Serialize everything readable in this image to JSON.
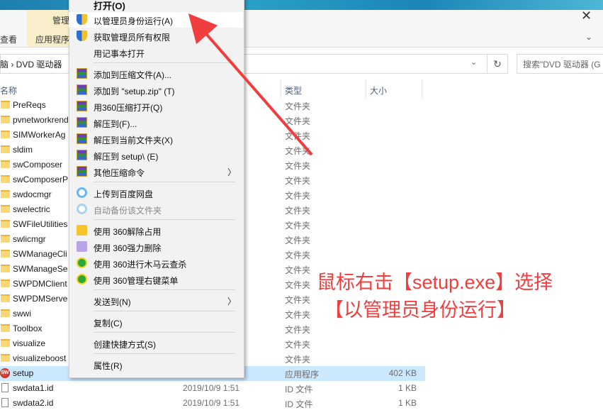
{
  "ribbon": {
    "manage_tab": "管理",
    "view_tab": "查看",
    "app_tools_tab": "应用程序"
  },
  "address": {
    "path": "脑 › DVD 驱动器",
    "search_placeholder": "搜索\"DVD 驱动器 (G"
  },
  "columns": {
    "name": "名称",
    "type": "类型",
    "size": "大小"
  },
  "files": [
    {
      "name": "PreReqs",
      "date": "",
      "type": "文件夹",
      "size": "",
      "kind": "folder"
    },
    {
      "name": "pvnetworkrend",
      "date": "",
      "type": "文件夹",
      "size": "",
      "kind": "folder"
    },
    {
      "name": "SIMWorkerAg",
      "date": "",
      "type": "文件夹",
      "size": "",
      "kind": "folder"
    },
    {
      "name": "sldim",
      "date": "",
      "type": "文件夹",
      "size": "",
      "kind": "folder"
    },
    {
      "name": "swComposer",
      "date": "",
      "type": "文件夹",
      "size": "",
      "kind": "folder"
    },
    {
      "name": "swComposerP",
      "date": "",
      "type": "文件夹",
      "size": "",
      "kind": "folder"
    },
    {
      "name": "swdocmgr",
      "date": "",
      "type": "文件夹",
      "size": "",
      "kind": "folder"
    },
    {
      "name": "swelectric",
      "date": "",
      "type": "文件夹",
      "size": "",
      "kind": "folder"
    },
    {
      "name": "SWFileUtilities",
      "date": "",
      "type": "文件夹",
      "size": "",
      "kind": "folder"
    },
    {
      "name": "swlicmgr",
      "date": "",
      "type": "文件夹",
      "size": "",
      "kind": "folder"
    },
    {
      "name": "SWManageCli",
      "date": "",
      "type": "文件夹",
      "size": "",
      "kind": "folder"
    },
    {
      "name": "SWManageSe",
      "date": "",
      "type": "文件夹",
      "size": "",
      "kind": "folder"
    },
    {
      "name": "SWPDMClient",
      "date": "",
      "type": "文件夹",
      "size": "",
      "kind": "folder"
    },
    {
      "name": "SWPDMServe",
      "date": "",
      "type": "文件夹",
      "size": "",
      "kind": "folder"
    },
    {
      "name": "swwi",
      "date": "",
      "type": "文件夹",
      "size": "",
      "kind": "folder"
    },
    {
      "name": "Toolbox",
      "date": "",
      "type": "文件夹",
      "size": "",
      "kind": "folder"
    },
    {
      "name": "visualize",
      "date": "",
      "type": "文件夹",
      "size": "",
      "kind": "folder"
    },
    {
      "name": "visualizeboost",
      "date": "",
      "type": "文件夹",
      "size": "",
      "kind": "folder"
    },
    {
      "name": "setup",
      "date": "",
      "type": "应用程序",
      "size": "402 KB",
      "kind": "exe"
    },
    {
      "name": "swdata1.id",
      "date": "2019/10/9 1:51",
      "type": "ID 文件",
      "size": "1 KB",
      "kind": "file"
    },
    {
      "name": "swdata2.id",
      "date": "2019/10/9 1:51",
      "type": "ID 文件",
      "size": "1 KB",
      "kind": "file"
    }
  ],
  "context_menu": {
    "open": "打开(O)",
    "run_as_admin": "以管理员身份运行(A)",
    "take_ownership": "获取管理员所有权限",
    "open_notepad": "用记事本打开",
    "add_to_archive": "添加到压缩文件(A)...",
    "add_to_zip": "添加到 \"setup.zip\" (T)",
    "open_with_360zip": "用360压缩打开(Q)",
    "extract_to": "解压到(F)...",
    "extract_here": "解压到当前文件夹(X)",
    "extract_to_setup": "解压到 setup\\ (E)",
    "other_zip": "其他压缩命令",
    "upload_baidu": "上传到百度网盘",
    "auto_backup": "自动备份该文件夹",
    "unlock_360": "使用 360解除占用",
    "force_delete_360": "使用 360强力删除",
    "trojan_scan_360": "使用 360进行木马云查杀",
    "manage_menu_360": "使用 360管理右键菜单",
    "send_to": "发送到(N)",
    "copy": "复制(C)",
    "create_shortcut": "创建快捷方式(S)",
    "properties": "属性(R)"
  },
  "annotation": {
    "line1": "鼠标右击【setup.exe】选择",
    "line2": "【以管理员身份运行】",
    "color": "#f03d3d"
  }
}
